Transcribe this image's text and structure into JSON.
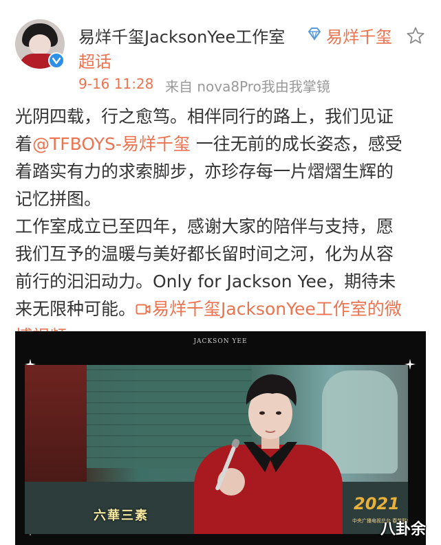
{
  "header": {
    "account_name": "易烊千玺JacksonYee工作室",
    "topic_line1": "易烊千玺",
    "topic_line2": "超话",
    "time": "9-16 11:28",
    "source": "来自 nova8Pro我由我掌镜"
  },
  "post": {
    "line1": "光阴四载，行之愈笃。相伴同行的路上，我们见证",
    "line2_prefix": "着",
    "mention": "@TFBOYS-易烊千玺",
    "line2_suffix": " 一往无前的成长姿态，感受",
    "line3": "着踏实有力的求索脚步，亦珍存每一片熠熠生辉的",
    "line4": "记忆拼图。",
    "line5": "工作室成立已至四年，感谢大家的陪伴与支持，愿",
    "line6": "我们互予的温暖与美好都长留时间之河，化为从容",
    "line7": "前行的汩汩动力。Only for Jackson Yee，期待未",
    "line8_prefix": "来无限种可能。",
    "video_link_part1": "易烊千玺JacksonYee工作室的微",
    "video_link_part2": "博视频"
  },
  "video": {
    "title": "JACKSON YEE",
    "caption": "六華三素",
    "stage_number": "2021",
    "stage_text": "中央广播电视总台 春节联欢晚会"
  },
  "watermark": "八卦余",
  "colors": {
    "link": "#eb7350",
    "text": "#333333",
    "muted": "#999999",
    "verified": "#2d8fe8"
  },
  "icons": [
    "verified-badge-icon",
    "diamond-icon",
    "star-icon",
    "video-link-icon",
    "sparkle-icon"
  ]
}
